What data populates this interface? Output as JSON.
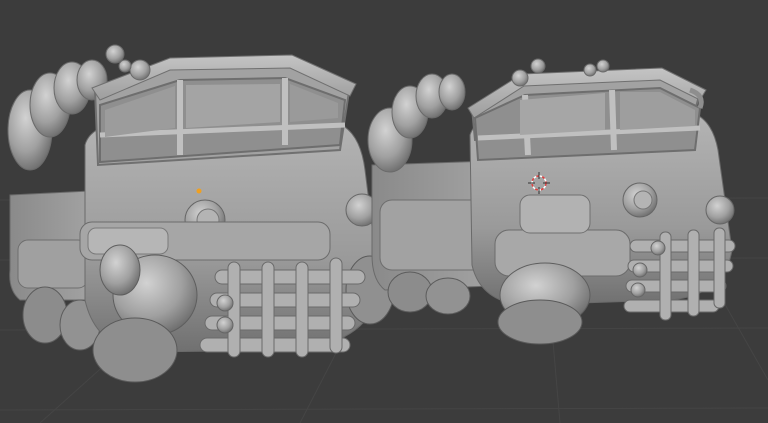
{
  "viewport": {
    "background": "#3c3c3c",
    "grid_color": "#474747",
    "horizon_color": "#4a4a4a"
  },
  "scene": {
    "objects": [
      "truck-left",
      "truck-right"
    ],
    "material_color": "#9a9a9a",
    "shadow_color": "#5e5e5e",
    "highlight_color": "#c6c6c6"
  },
  "cursor": {
    "icon": "3d-cursor-icon",
    "color_a": "#e04040",
    "color_b": "#ffffff"
  },
  "origin": {
    "icon": "object-origin-icon",
    "color": "#f0a020"
  }
}
